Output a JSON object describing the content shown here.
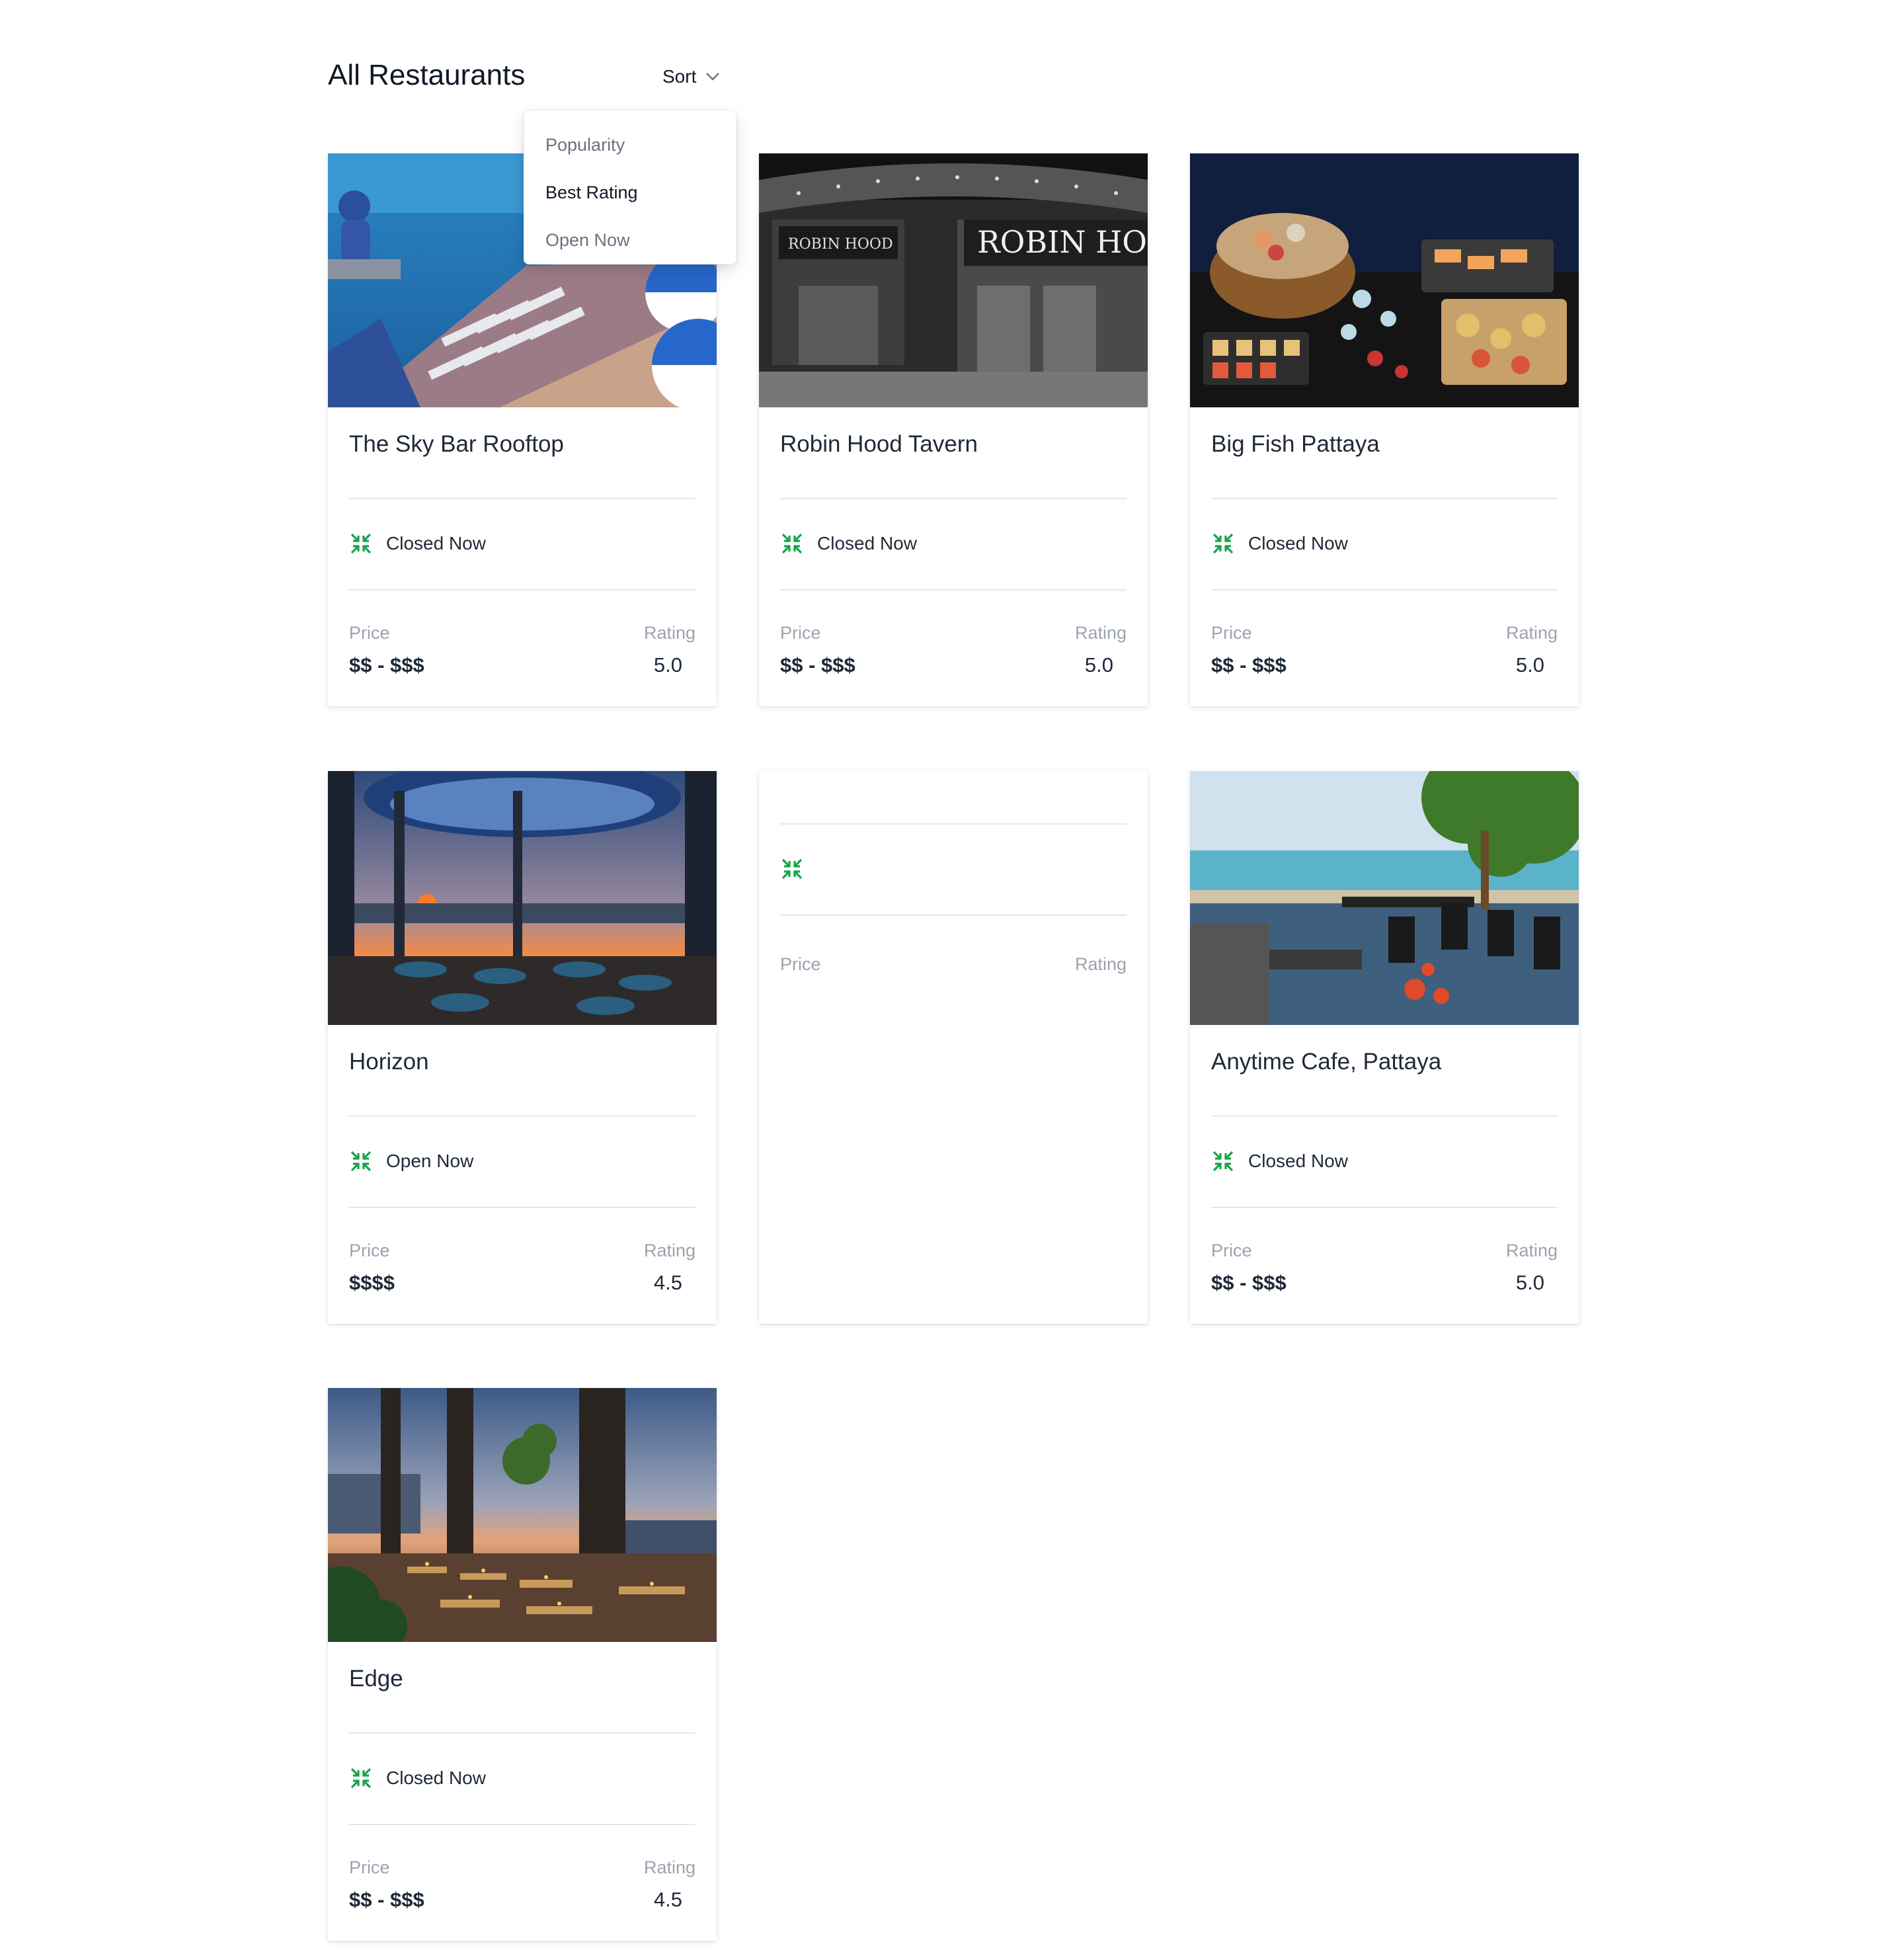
{
  "header": {
    "title": "All Restaurants",
    "sort_label": "Sort"
  },
  "sort_menu": {
    "options": [
      "Popularity",
      "Best Rating",
      "Open Now"
    ],
    "selected": "Best Rating"
  },
  "labels": {
    "price": "Price",
    "rating": "Rating"
  },
  "colors": {
    "status_icon": "#16a34a",
    "text": "#1f2937",
    "muted": "#9ca3af"
  },
  "restaurants": [
    {
      "name": "The Sky Bar Rooftop",
      "status": "Closed Now",
      "price": "$$ - $$$",
      "rating": "5.0",
      "image": "rooftop-pool-photo"
    },
    {
      "name": "Robin Hood Tavern",
      "status": "Closed Now",
      "price": "$$ - $$$",
      "rating": "5.0",
      "image": "tavern-storefront-photo"
    },
    {
      "name": "Big Fish Pattaya",
      "status": "Closed Now",
      "price": "$$ - $$$",
      "rating": "5.0",
      "image": "seafood-platter-photo"
    },
    {
      "name": "Horizon",
      "status": "Open Now",
      "price": "$$$$",
      "rating": "4.5",
      "image": "sunset-terrace-photo"
    },
    {
      "name": "",
      "status": "",
      "price": "",
      "rating": "",
      "image": ""
    },
    {
      "name": "Anytime Cafe, Pattaya",
      "status": "Closed Now",
      "price": "$$ - $$$",
      "rating": "5.0",
      "image": "beach-cafe-photo"
    },
    {
      "name": "Edge",
      "status": "Closed Now",
      "price": "$$ - $$$",
      "rating": "4.5",
      "image": "evening-dining-photo"
    }
  ]
}
